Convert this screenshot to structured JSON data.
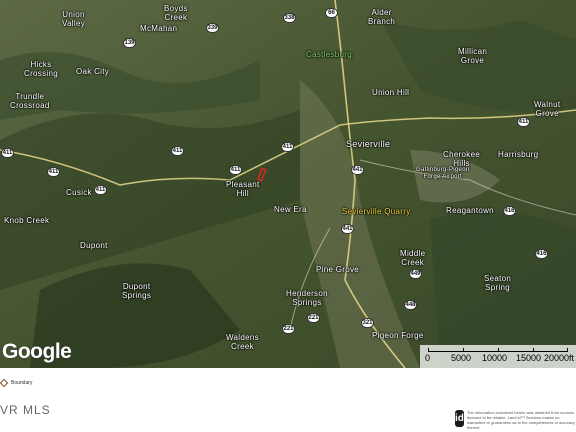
{
  "map": {
    "places": [
      {
        "id": "union-valley",
        "name": "Union\nValley",
        "type": "town"
      },
      {
        "id": "mcmahan",
        "name": "McMahan",
        "type": "town"
      },
      {
        "id": "boyds-creek",
        "name": "Boyds\nCreek",
        "type": "town"
      },
      {
        "id": "alder-branch",
        "name": "Alder\nBranch",
        "type": "town"
      },
      {
        "id": "castlesburg",
        "name": "Castlesburg",
        "type": "town"
      },
      {
        "id": "millican-grove",
        "name": "Millican\nGrove",
        "type": "town"
      },
      {
        "id": "hicks-crossing",
        "name": "Hicks\nCrossing",
        "type": "town"
      },
      {
        "id": "oak-city",
        "name": "Oak City",
        "type": "town"
      },
      {
        "id": "trundle-crossroad",
        "name": "Trundle\nCrossroad",
        "type": "town"
      },
      {
        "id": "union-hill",
        "name": "Union Hill",
        "type": "town"
      },
      {
        "id": "walnut-grove",
        "name": "Walnut\nGrove",
        "type": "town"
      },
      {
        "id": "sevierville",
        "name": "Sevierville",
        "type": "city"
      },
      {
        "id": "cherokee-hills",
        "name": "Cherokee\nHills",
        "type": "town"
      },
      {
        "id": "harrisburg",
        "name": "Harrisburg",
        "type": "town"
      },
      {
        "id": "airport",
        "name": "Gatlinburg-Pigeon\nForge Airport",
        "type": "town"
      },
      {
        "id": "cusick",
        "name": "Cusick",
        "type": "town"
      },
      {
        "id": "pleasant-hill",
        "name": "Pleasant\nHill",
        "type": "town"
      },
      {
        "id": "knob-creek",
        "name": "Knob Creek",
        "type": "town"
      },
      {
        "id": "new-era",
        "name": "New Era",
        "type": "town"
      },
      {
        "id": "sevierville-quarry",
        "name": "Sevierville Quarry",
        "type": "poi"
      },
      {
        "id": "reagantown",
        "name": "Reagantown",
        "type": "town"
      },
      {
        "id": "dupont",
        "name": "Dupont",
        "type": "town"
      },
      {
        "id": "middle-creek",
        "name": "Middle\nCreek",
        "type": "town"
      },
      {
        "id": "pine-grove",
        "name": "Pine Grove",
        "type": "town"
      },
      {
        "id": "seaton-spring",
        "name": "Seaton\nSpring",
        "type": "town"
      },
      {
        "id": "dupont-springs",
        "name": "Dupont\nSprings",
        "type": "town"
      },
      {
        "id": "henderson-springs",
        "name": "Henderson\nSprings",
        "type": "town"
      },
      {
        "id": "waldens-creek",
        "name": "Waldens\nCreek",
        "type": "town"
      },
      {
        "id": "pigeon-forge",
        "name": "Pigeon Forge",
        "type": "town"
      }
    ],
    "shields": [
      {
        "id": "r338",
        "label": "338"
      },
      {
        "id": "r339",
        "label": "339"
      },
      {
        "id": "r66",
        "label": "66"
      },
      {
        "id": "r139",
        "label": "139"
      },
      {
        "id": "r411-a",
        "label": "411"
      },
      {
        "id": "r411-b",
        "label": "411"
      },
      {
        "id": "r411-c",
        "label": "411"
      },
      {
        "id": "r411-d",
        "label": "411"
      },
      {
        "id": "r411-e",
        "label": "411"
      },
      {
        "id": "r411-f",
        "label": "411"
      },
      {
        "id": "r411-g",
        "label": "411"
      },
      {
        "id": "r441-a",
        "label": "441"
      },
      {
        "id": "r441-b",
        "label": "441"
      },
      {
        "id": "r449",
        "label": "449"
      },
      {
        "id": "r448",
        "label": "448"
      },
      {
        "id": "r416-a",
        "label": "416"
      },
      {
        "id": "r416-b",
        "label": "416"
      },
      {
        "id": "r321",
        "label": "321"
      },
      {
        "id": "r221-a",
        "label": "221"
      },
      {
        "id": "r221-b",
        "label": "221"
      }
    ],
    "attribution": "Google",
    "scale": {
      "labels": [
        "0",
        "5000",
        "10000",
        "15000",
        "20000ft"
      ]
    }
  },
  "legend": {
    "boundary_label": "Boundary"
  },
  "footer": {
    "mls_label": "VR MLS",
    "id_icon": "id",
    "disclaimer": "The information contained herein was obtained from sources deemed to be reliable. Land id™ Services makes no warranties or guarantees as to the completeness or accuracy thereof."
  },
  "colors": {
    "boundary": "#e0241b",
    "road": "#e8d98a",
    "terrain": "#4a5a36"
  }
}
